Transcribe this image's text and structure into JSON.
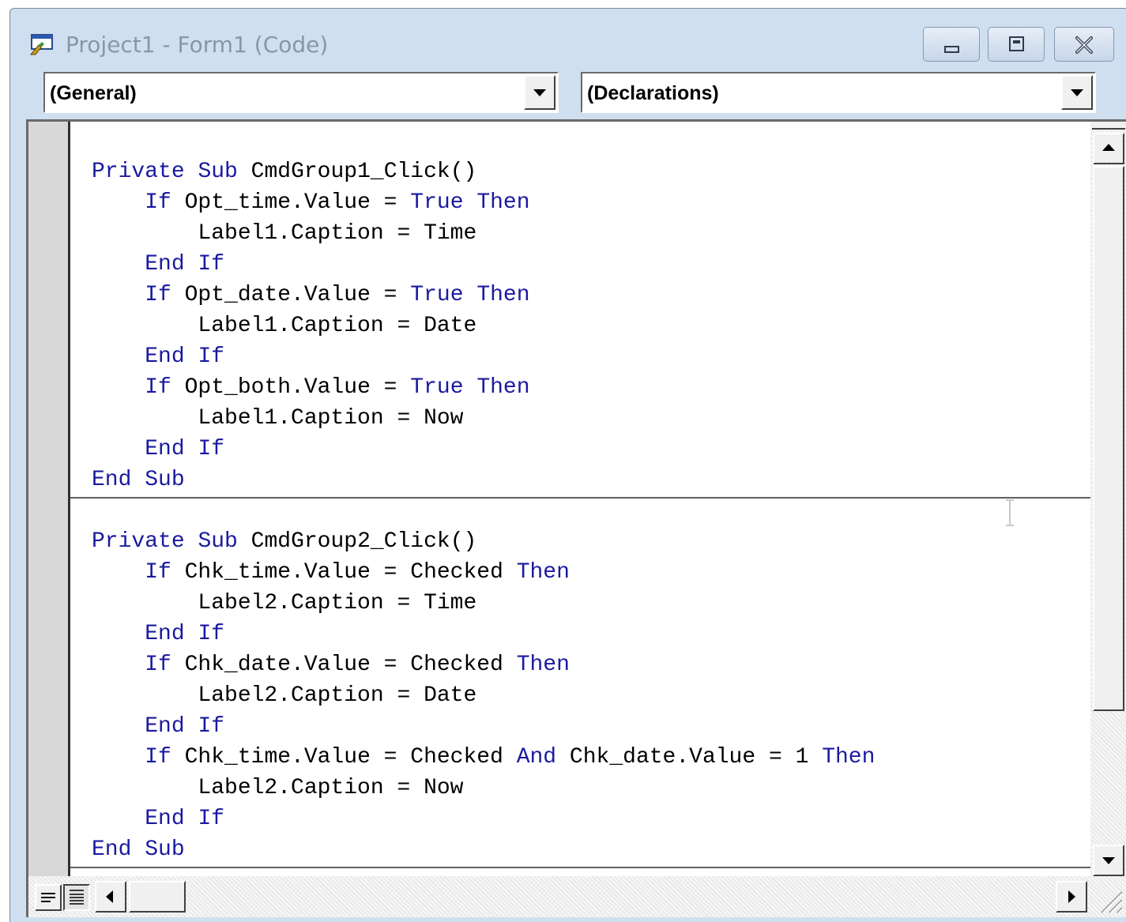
{
  "window": {
    "title": "Project1 - Form1 (Code)",
    "icon": "vb-code-window-icon",
    "controls": [
      "minimize-icon",
      "maximize-icon",
      "close-icon"
    ]
  },
  "object_combo": {
    "selected": "(General)"
  },
  "procedure_combo": {
    "selected": "(Declarations)"
  },
  "code": {
    "procedures": [
      {
        "lines": [
          [
            [
              "kw",
              "Private"
            ],
            [
              "t",
              " "
            ],
            [
              "kw",
              "Sub"
            ],
            [
              "t",
              " CmdGroup1_Click()"
            ]
          ],
          [
            [
              "t",
              "    "
            ],
            [
              "kw",
              "If"
            ],
            [
              "t",
              " Opt_time.Value = "
            ],
            [
              "kw",
              "True"
            ],
            [
              "t",
              " "
            ],
            [
              "kw",
              "Then"
            ]
          ],
          [
            [
              "t",
              "        Label1.Caption = Time"
            ]
          ],
          [
            [
              "t",
              "    "
            ],
            [
              "kw",
              "End"
            ],
            [
              "t",
              " "
            ],
            [
              "kw",
              "If"
            ]
          ],
          [
            [
              "t",
              "    "
            ],
            [
              "kw",
              "If"
            ],
            [
              "t",
              " Opt_date.Value = "
            ],
            [
              "kw",
              "True"
            ],
            [
              "t",
              " "
            ],
            [
              "kw",
              "Then"
            ]
          ],
          [
            [
              "t",
              "        Label1.Caption = Date"
            ]
          ],
          [
            [
              "t",
              "    "
            ],
            [
              "kw",
              "End"
            ],
            [
              "t",
              " "
            ],
            [
              "kw",
              "If"
            ]
          ],
          [
            [
              "t",
              "    "
            ],
            [
              "kw",
              "If"
            ],
            [
              "t",
              " Opt_both.Value = "
            ],
            [
              "kw",
              "True"
            ],
            [
              "t",
              " "
            ],
            [
              "kw",
              "Then"
            ]
          ],
          [
            [
              "t",
              "        Label1.Caption = Now"
            ]
          ],
          [
            [
              "t",
              "    "
            ],
            [
              "kw",
              "End"
            ],
            [
              "t",
              " "
            ],
            [
              "kw",
              "If"
            ]
          ],
          [
            [
              "kw",
              "End"
            ],
            [
              "t",
              " "
            ],
            [
              "kw",
              "Sub"
            ]
          ]
        ]
      },
      {
        "lines": [
          [
            [
              "kw",
              "Private"
            ],
            [
              "t",
              " "
            ],
            [
              "kw",
              "Sub"
            ],
            [
              "t",
              " CmdGroup2_Click()"
            ]
          ],
          [
            [
              "t",
              "    "
            ],
            [
              "kw",
              "If"
            ],
            [
              "t",
              " Chk_time.Value = Checked "
            ],
            [
              "kw",
              "Then"
            ]
          ],
          [
            [
              "t",
              "        Label2.Caption = Time"
            ]
          ],
          [
            [
              "t",
              "    "
            ],
            [
              "kw",
              "End"
            ],
            [
              "t",
              " "
            ],
            [
              "kw",
              "If"
            ]
          ],
          [
            [
              "t",
              "    "
            ],
            [
              "kw",
              "If"
            ],
            [
              "t",
              " Chk_date.Value = Checked "
            ],
            [
              "kw",
              "Then"
            ]
          ],
          [
            [
              "t",
              "        Label2.Caption = Date"
            ]
          ],
          [
            [
              "t",
              "    "
            ],
            [
              "kw",
              "End"
            ],
            [
              "t",
              " "
            ],
            [
              "kw",
              "If"
            ]
          ],
          [
            [
              "t",
              "    "
            ],
            [
              "kw",
              "If"
            ],
            [
              "t",
              " Chk_time.Value = Checked "
            ],
            [
              "kw",
              "And"
            ],
            [
              "t",
              " Chk_date.Value = 1 "
            ],
            [
              "kw",
              "Then"
            ]
          ],
          [
            [
              "t",
              "        Label2.Caption = Now"
            ]
          ],
          [
            [
              "t",
              "    "
            ],
            [
              "kw",
              "End"
            ],
            [
              "t",
              " "
            ],
            [
              "kw",
              "If"
            ]
          ],
          [
            [
              "kw",
              "End"
            ],
            [
              "t",
              " "
            ],
            [
              "kw",
              "Sub"
            ]
          ]
        ]
      }
    ]
  },
  "colors": {
    "keyword": "#1a1aa0",
    "identifier": "#000000",
    "titlebar": "#cfdff0",
    "title_text": "#8a96a8"
  },
  "bottom_bar": {
    "view_buttons": [
      "procedure-view-icon",
      "full-module-view-icon"
    ],
    "active_view": "full-module-view-icon"
  }
}
